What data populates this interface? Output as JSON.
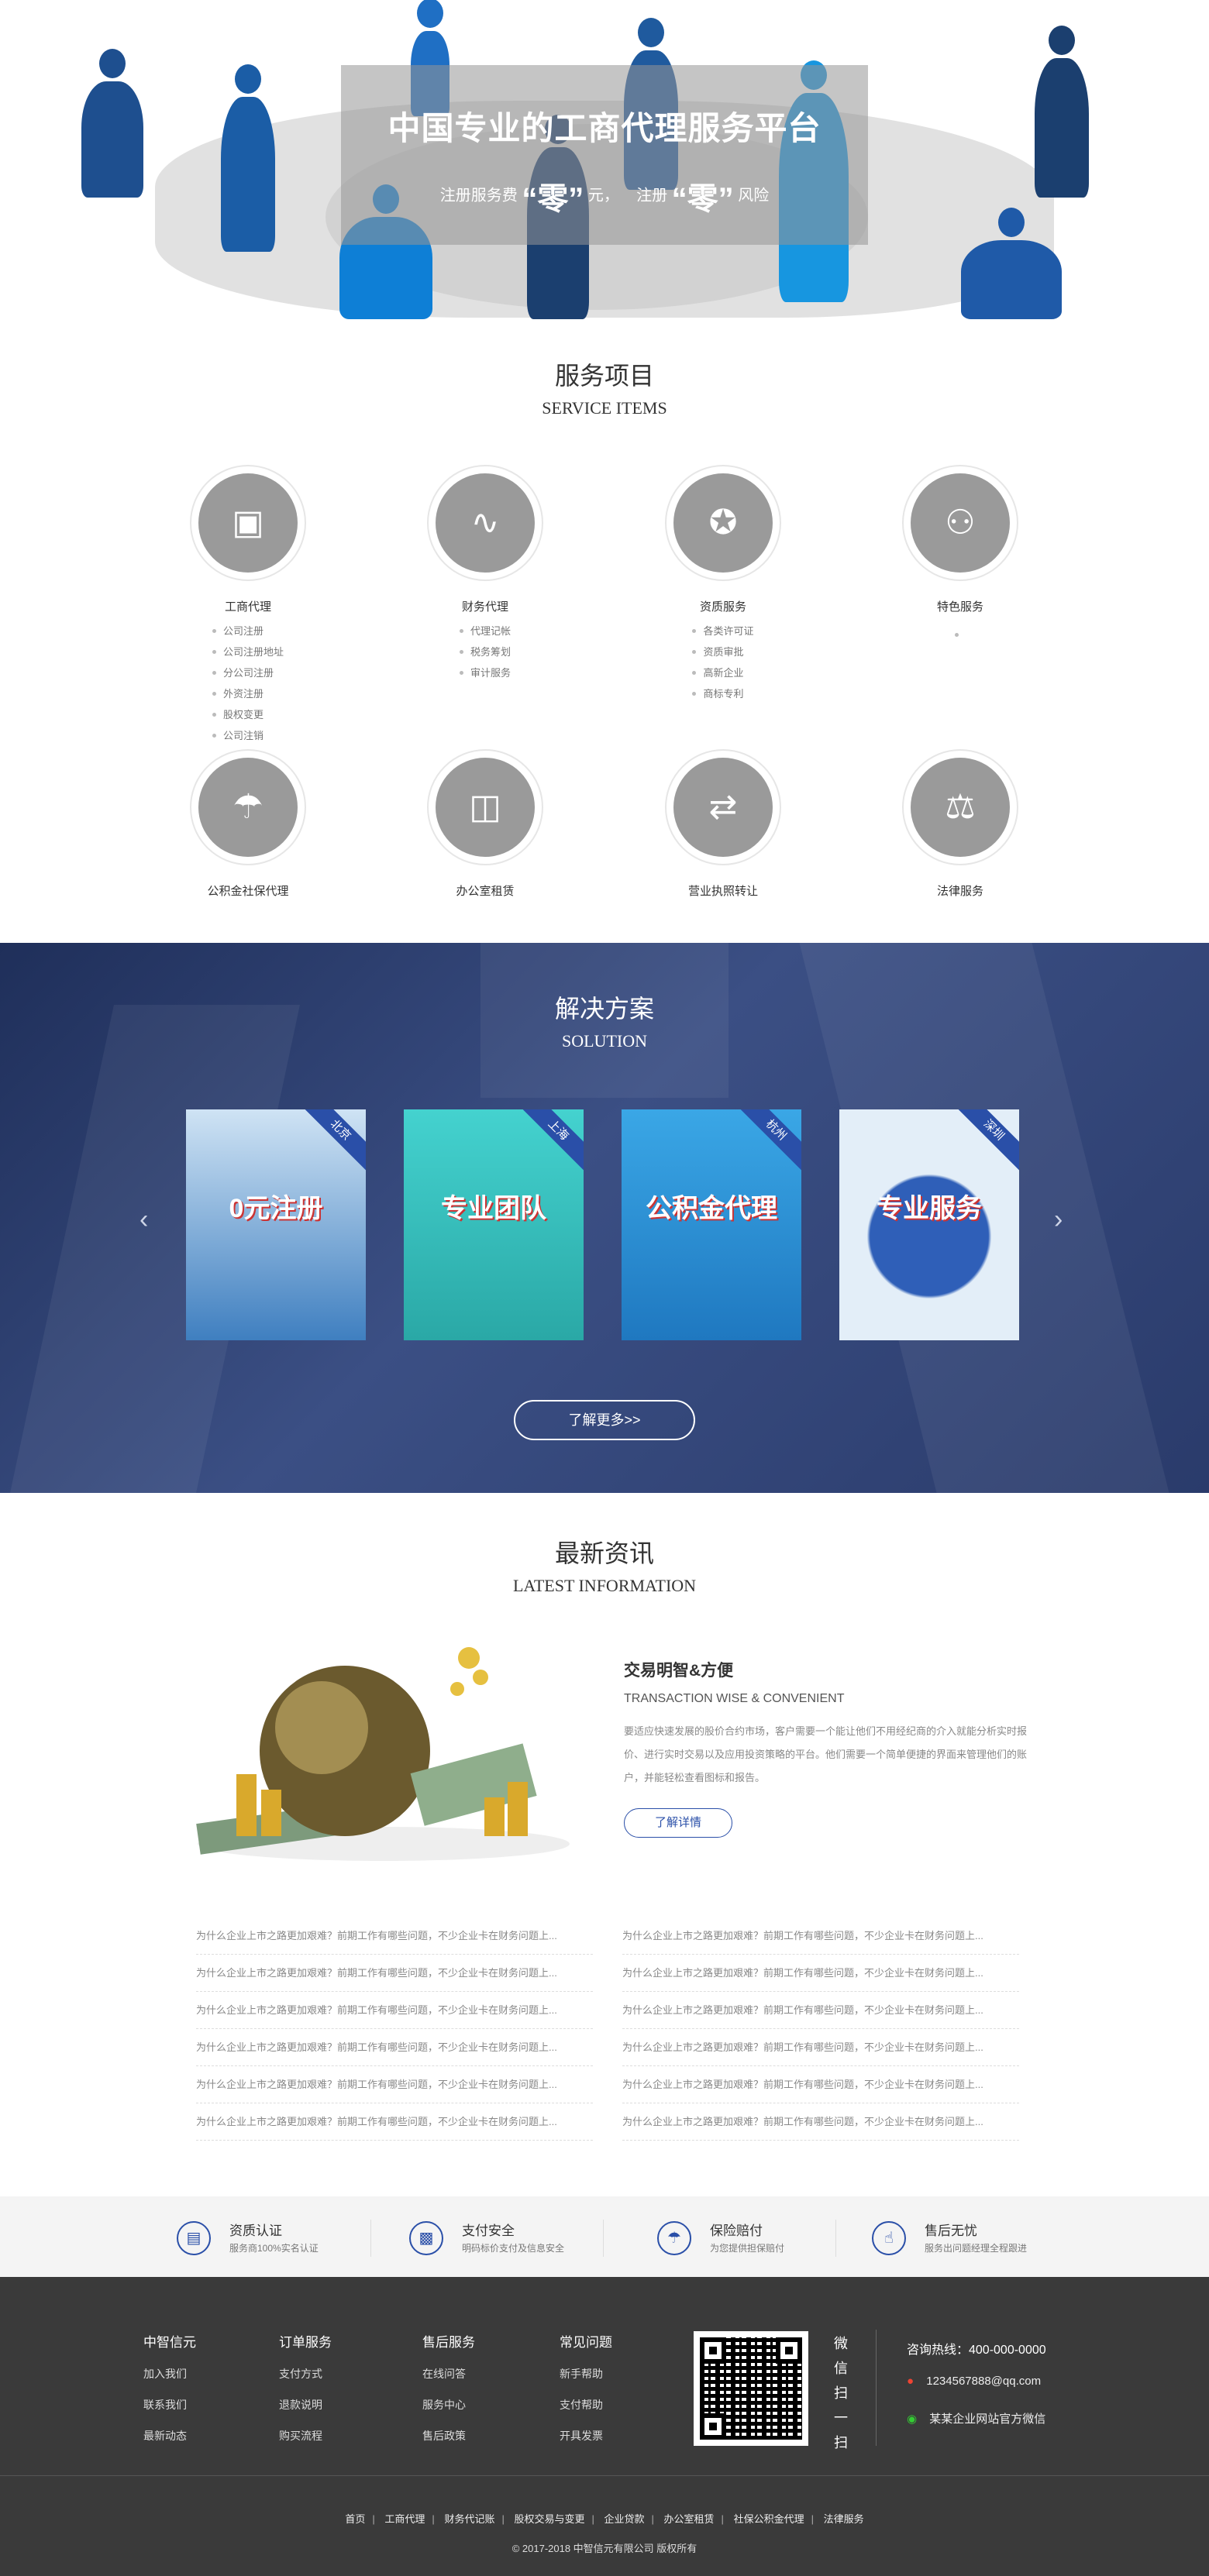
{
  "hero": {
    "title": "中国专业的工商代理服务平台",
    "sub_a": "注册服务费",
    "sub_zero1": "“零”",
    "sub_b": "元，",
    "sub_c": "注册",
    "sub_zero2": "“零”",
    "sub_d": "风险"
  },
  "services": {
    "title_cn": "服务项目",
    "title_en": "SERVICE ITEMS",
    "row1": [
      {
        "name": "工商代理",
        "icon": "briefcase-icon",
        "items": [
          "公司注册",
          "公司注册地址",
          "分公司注册",
          "外资注册",
          "股权变更",
          "公司注销"
        ]
      },
      {
        "name": "财务代理",
        "icon": "chart-icon",
        "items": [
          "代理记帐",
          "税务筹划",
          "审计服务"
        ]
      },
      {
        "name": "资质服务",
        "icon": "award-icon",
        "items": [
          "各类许可证",
          "资质审批",
          "高新企业",
          "商标专利"
        ]
      },
      {
        "name": "特色服务",
        "icon": "trophy-icon",
        "items": [
          ""
        ]
      }
    ],
    "row2": [
      {
        "name": "公积金社保代理",
        "icon": "umbrella-icon"
      },
      {
        "name": "办公室租赁",
        "icon": "door-icon"
      },
      {
        "name": "营业执照转让",
        "icon": "transfer-icon"
      },
      {
        "name": "法律服务",
        "icon": "scales-icon"
      }
    ]
  },
  "solution": {
    "title_cn": "解决方案",
    "title_en": "SOLUTION",
    "prev_glyph": "‹",
    "next_glyph": "›",
    "cards": [
      {
        "city": "北京",
        "text": "0元注册",
        "bg": "#3f7fc0"
      },
      {
        "city": "上海",
        "text": "专业团队",
        "bg": "#35c6c4"
      },
      {
        "city": "杭州",
        "text": "公积金代理",
        "bg": "#2d9de0"
      },
      {
        "city": "深圳",
        "text": "专业服务",
        "bg": "#cfe1f2"
      }
    ],
    "more_label": "了解更多>>"
  },
  "news": {
    "title_cn": "最新资讯",
    "title_en": "LATEST INFORMATION",
    "feature_title": "交易明智&方便",
    "feature_en": "TRANSACTION WISE & CONVENIENT",
    "feature_desc": "要适应快速发展的股价合约市场，客户需要一个能让他们不用经纪商的介入就能分析实时报价、进行实时交易以及应用投资策略的平台。他们需要一个简单便捷的界面来管理他们的账户，并能轻松查看图标和报告。",
    "feature_btn": "了解详情",
    "left_list": [
      "为什么企业上市之路更加艰难？前期工作有哪些问题，不少企业卡在财务问题上...",
      "为什么企业上市之路更加艰难？前期工作有哪些问题，不少企业卡在财务问题上...",
      "为什么企业上市之路更加艰难？前期工作有哪些问题，不少企业卡在财务问题上...",
      "为什么企业上市之路更加艰难？前期工作有哪些问题，不少企业卡在财务问题上...",
      "为什么企业上市之路更加艰难？前期工作有哪些问题，不少企业卡在财务问题上...",
      "为什么企业上市之路更加艰难？前期工作有哪些问题，不少企业卡在财务问题上..."
    ],
    "right_list": [
      "为什么企业上市之路更加艰难？前期工作有哪些问题，不少企业卡在财务问题上...",
      "为什么企业上市之路更加艰难？前期工作有哪些问题，不少企业卡在财务问题上...",
      "为什么企业上市之路更加艰难？前期工作有哪些问题，不少企业卡在财务问题上...",
      "为什么企业上市之路更加艰难？前期工作有哪些问题，不少企业卡在财务问题上...",
      "为什么企业上市之路更加艰难？前期工作有哪些问题，不少企业卡在财务问题上...",
      "为什么企业上市之路更加艰难？前期工作有哪些问题，不少企业卡在财务问题上..."
    ]
  },
  "features": [
    {
      "title": "资质认证",
      "desc": "服务商100%实名认证",
      "icon": "certificate-icon"
    },
    {
      "title": "支付安全",
      "desc": "明码标价支付及信息安全",
      "icon": "wallet-icon"
    },
    {
      "title": "保险赔付",
      "desc": "为您提供担保赔付",
      "icon": "umbrella-icon"
    },
    {
      "title": "售后无忧",
      "desc": "服务出问题经理全程跟进",
      "icon": "thumbs-up-icon"
    }
  ],
  "footer": {
    "cols": [
      {
        "title": "中智信元",
        "links": [
          "加入我们",
          "联系我们",
          "最新动态"
        ]
      },
      {
        "title": "订单服务",
        "links": [
          "支付方式",
          "退款说明",
          "购买流程"
        ]
      },
      {
        "title": "售后服务",
        "links": [
          "在线问答",
          "服务中心",
          "售后政策"
        ]
      },
      {
        "title": "常见问题",
        "links": [
          "新手帮助",
          "支付帮助",
          "开具发票"
        ]
      }
    ],
    "wechat_scan": [
      "微",
      "信",
      "扫",
      "一",
      "扫"
    ],
    "hotline": "咨询热线：400-000-0000",
    "qq": "1234567888@qq.com",
    "wechat": "某某企业网站官方微信",
    "links": [
      "首页",
      "工商代理",
      "财务代记账",
      "股权交易与变更",
      "企业贷款",
      "办公室租赁",
      "社保公积金代理",
      "法律服务"
    ],
    "copyright": "© 2017-2018 中智信元有限公司 版权所有"
  }
}
